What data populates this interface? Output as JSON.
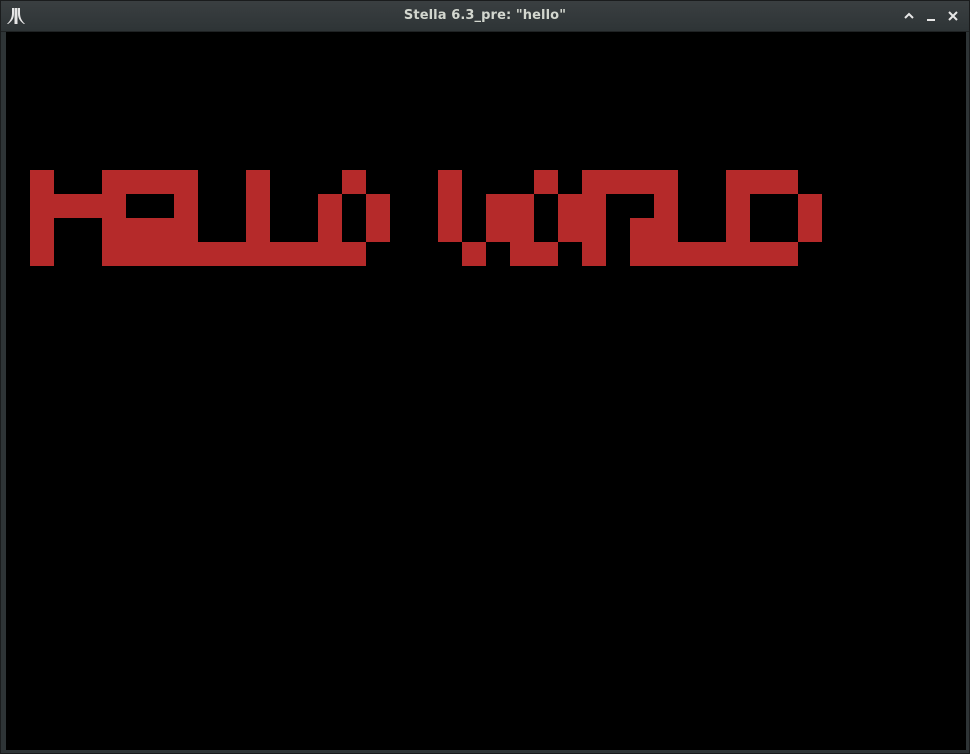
{
  "window": {
    "title": "Stella 6.3_pre: \"hello\"",
    "app_icon": "atari-logo-icon",
    "controls": [
      {
        "name": "maximize-button",
        "icon": "chevron-up-icon"
      },
      {
        "name": "minimize-button",
        "icon": "minimize-icon"
      },
      {
        "name": "close-button",
        "icon": "close-icon"
      }
    ]
  },
  "screen": {
    "background": "#000000",
    "text_color": "#b52a2a",
    "message": "HELLO WORLD"
  }
}
